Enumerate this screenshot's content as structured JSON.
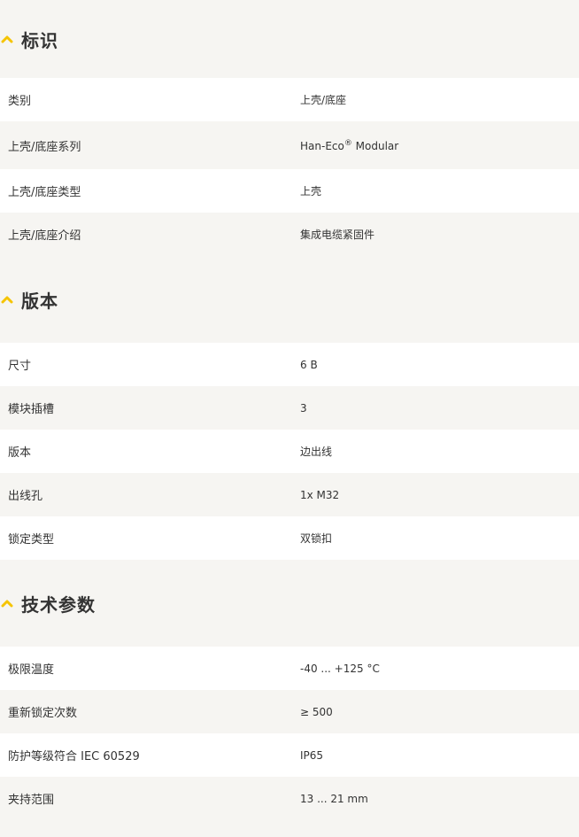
{
  "accent_color": "#f5c400",
  "sections": [
    {
      "title": "标识",
      "rows": [
        {
          "label": "类别",
          "value": "上壳/底座"
        },
        {
          "label": "上壳/底座系列",
          "value": "Han-Eco",
          "value_sup": "®",
          "value_suffix": " Modular"
        },
        {
          "label": "上壳/底座类型",
          "value": "上壳"
        },
        {
          "label": "上壳/底座介绍",
          "value": "集成电缆紧固件"
        }
      ]
    },
    {
      "title": "版本",
      "rows": [
        {
          "label": "尺寸",
          "value": "6 B"
        },
        {
          "label": "模块插槽",
          "value": "3"
        },
        {
          "label": "版本",
          "value": "边出线"
        },
        {
          "label": "出线孔",
          "value": "1x M32"
        },
        {
          "label": "锁定类型",
          "value": "双锁扣"
        }
      ]
    },
    {
      "title": "技术参数",
      "rows": [
        {
          "label": "极限温度",
          "value": "-40 ... +125 °C"
        },
        {
          "label": "重新锁定次数",
          "value": "≥ 500"
        },
        {
          "label": "防护等级符合 IEC 60529",
          "value": "IP65"
        },
        {
          "label": "夹持范围",
          "value": "13 ... 21 mm"
        }
      ]
    }
  ]
}
